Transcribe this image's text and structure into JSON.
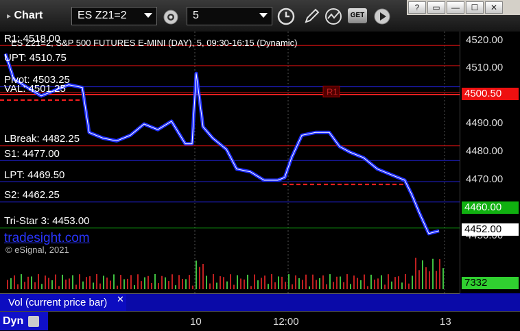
{
  "toolbar": {
    "app_title": "Chart",
    "symbol": "ES Z21=2",
    "interval": "5",
    "get_label": "GET"
  },
  "window_controls": [
    "?",
    "▭",
    "—",
    "☐",
    "✕"
  ],
  "chart": {
    "header": "ES Z21=2, S&P 500 FUTURES E-MINI (DAY), 5, 09:30-16:15 (Dynamic)",
    "brand": "tradesight.com",
    "copyright": "© eSignal, 2021",
    "levels": [
      {
        "id": "r1",
        "label": "R1: 4518.00",
        "price": 4518.0,
        "color": "#d01010"
      },
      {
        "id": "upt",
        "label": "UPT: 4510.75",
        "price": 4510.75,
        "color": "#d01010"
      },
      {
        "id": "pivot",
        "label": "Pivot: 4503.25",
        "price": 4503.25,
        "color": "#2020d0"
      },
      {
        "id": "val",
        "label": "VAL: 4501.25",
        "price": 4501.25,
        "color": "#d01010"
      },
      {
        "id": "lbreak",
        "label": "LBreak: 4482.25",
        "price": 4482.25,
        "color": "#d01010"
      },
      {
        "id": "s1",
        "label": "S1: 4477.00",
        "price": 4477.0,
        "color": "#2020d0"
      },
      {
        "id": "lpt",
        "label": "LPT: 4469.50",
        "price": 4469.5,
        "color": "#2020d0"
      },
      {
        "id": "s2",
        "label": "S2: 4462.25",
        "price": 4462.25,
        "color": "#2020d0"
      },
      {
        "id": "tristar",
        "label": "Tri-Star 3: 4453.00",
        "price": 4453.0,
        "color": "#10a010"
      }
    ],
    "marker_r1": "R1"
  },
  "price_axis": {
    "ticks": [
      "4520.00",
      "4510.00",
      "4490.00",
      "4480.00",
      "4470.00",
      "4450.00"
    ],
    "tag_red": "4500.50",
    "tag_green": "4460.00",
    "tag_white": "4452.00",
    "tag_volume": "7332"
  },
  "volume_panel": {
    "label": "Vol (current price bar)",
    "close": "✕"
  },
  "time_axis": {
    "ticks": [
      "10",
      "12:00",
      "13"
    ],
    "tab_label": "Dyn"
  },
  "colors": {
    "candle": "#2030ff",
    "grid": "#555555"
  }
}
